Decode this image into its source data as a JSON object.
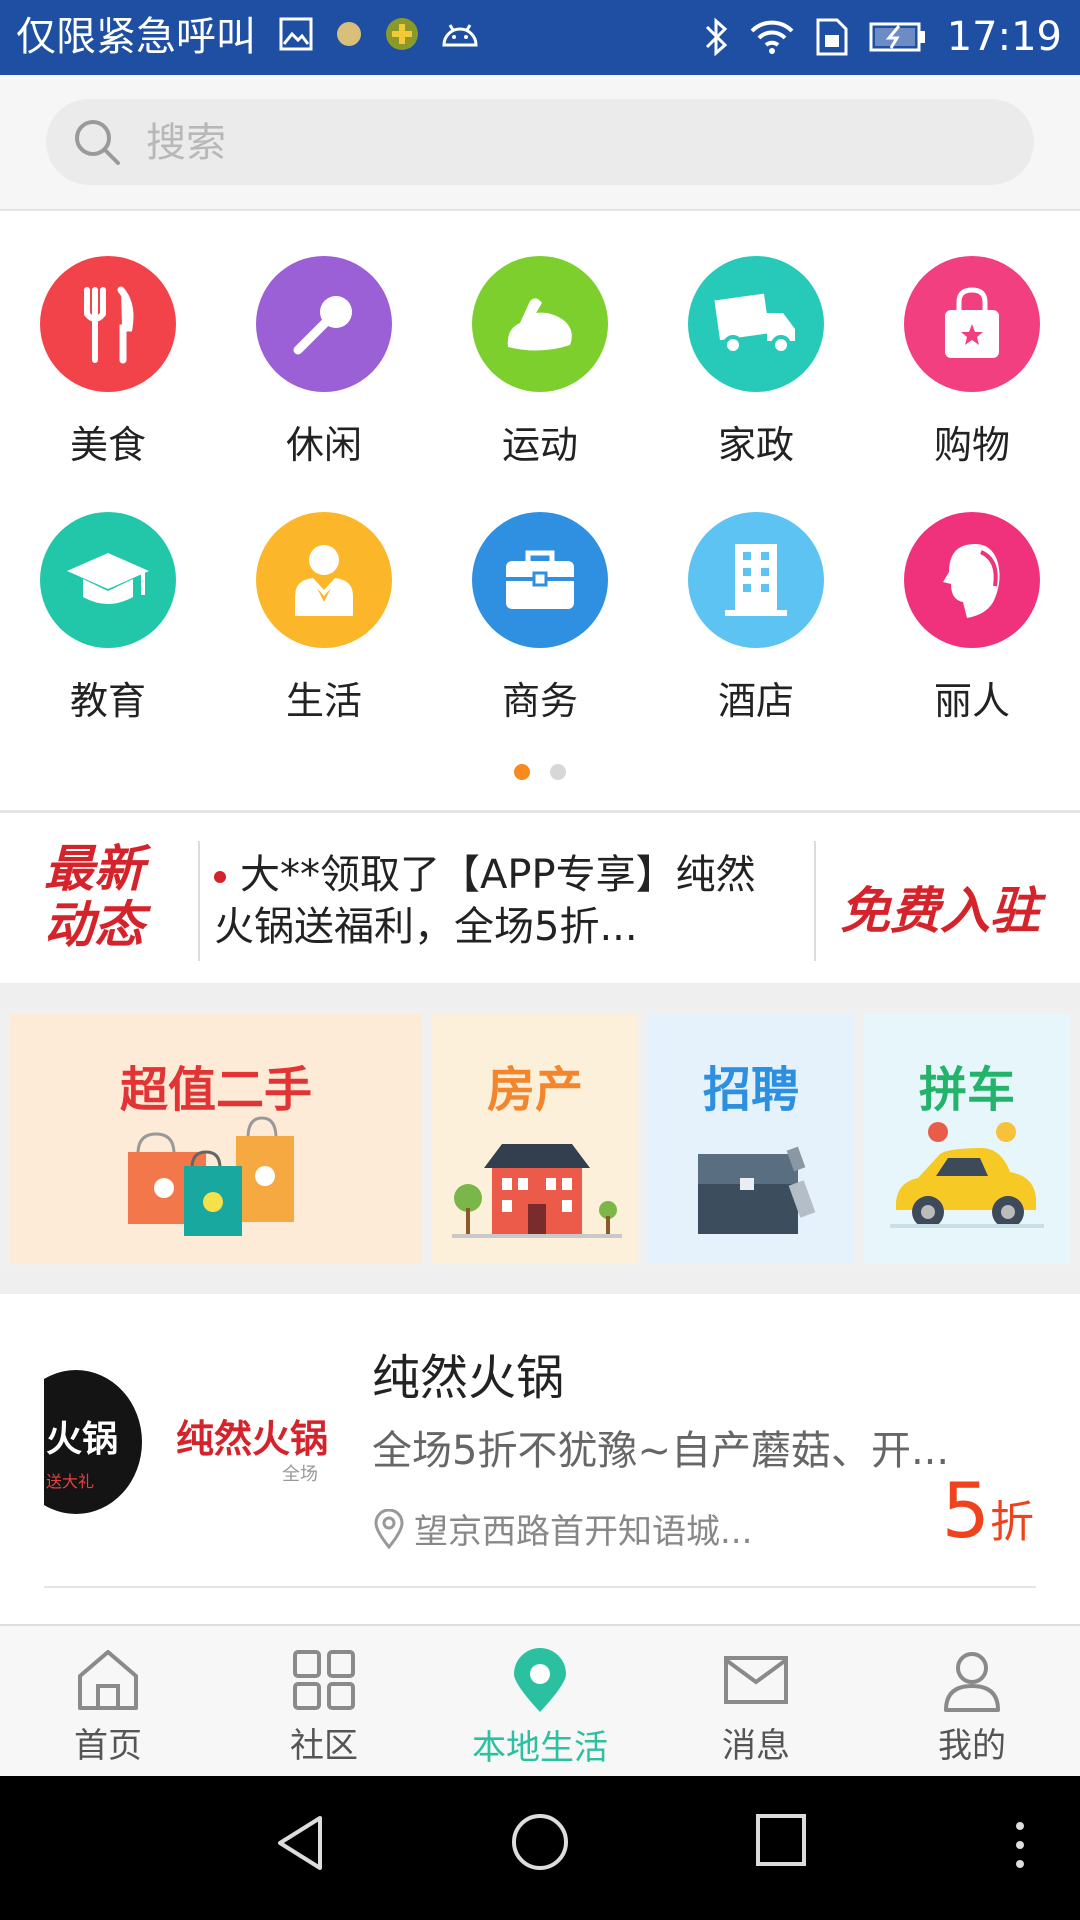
{
  "status_bar": {
    "carrier_text": "仅限紧急呼叫",
    "time": "17:19",
    "icons": [
      "gallery-icon",
      "dot-icon",
      "game-icon",
      "android-icon",
      "bluetooth-icon",
      "wifi-icon",
      "sim-icon",
      "battery-icon"
    ]
  },
  "search": {
    "placeholder": "搜索",
    "value": ""
  },
  "categories": [
    {
      "label": "美食",
      "icon": "fork-knife-icon",
      "color": "#f2434b"
    },
    {
      "label": "休闲",
      "icon": "microphone-icon",
      "color": "#9b5fd6"
    },
    {
      "label": "运动",
      "icon": "bicep-icon",
      "color": "#7dcf2e"
    },
    {
      "label": "家政",
      "icon": "truck-icon",
      "color": "#27c9b8"
    },
    {
      "label": "购物",
      "icon": "shopping-bag-icon",
      "color": "#f23f80"
    },
    {
      "label": "教育",
      "icon": "graduation-cap-icon",
      "color": "#22c6a8"
    },
    {
      "label": "生活",
      "icon": "person-icon",
      "color": "#fbb62a"
    },
    {
      "label": "商务",
      "icon": "briefcase-icon",
      "color": "#2f8fe0"
    },
    {
      "label": "酒店",
      "icon": "building-icon",
      "color": "#5cc3f2"
    },
    {
      "label": "丽人",
      "icon": "woman-profile-icon",
      "color": "#f0327d"
    }
  ],
  "pager": {
    "total": 2,
    "active": 1
  },
  "news": {
    "title_line1": "最新",
    "title_line2": "动态",
    "text": "大**领取了【APP专享】纯然火锅送福利，全场5折...",
    "join_label": "免费入驻"
  },
  "promos": [
    {
      "label": "超值二手",
      "color": "#e23434",
      "bg": "#fdebd8"
    },
    {
      "label": "房产",
      "color": "#f3862c",
      "bg": "#fdf0db"
    },
    {
      "label": "招聘",
      "color": "#2c8fe0",
      "bg": "#e6f2fb"
    },
    {
      "label": "拼车",
      "color": "#23b36b",
      "bg": "#e6f6fb"
    }
  ],
  "listing": {
    "title": "纯然火锅",
    "desc": "全场5折不犹豫~自产蘑菇、开...",
    "address": "望京西路首开知语城...",
    "discount_num": "5",
    "discount_unit": "折",
    "thumb_text_logo": "火锅",
    "thumb_text_sub": "送大礼",
    "thumb_text_name": "纯然火锅",
    "thumb_text_small": "全场"
  },
  "tabs": [
    {
      "label": "首页",
      "icon": "home-icon"
    },
    {
      "label": "社区",
      "icon": "grid-icon"
    },
    {
      "label": "本地生活",
      "icon": "location-pin-icon",
      "active": true
    },
    {
      "label": "消息",
      "icon": "mail-icon"
    },
    {
      "label": "我的",
      "icon": "user-icon"
    }
  ],
  "colors": {
    "accent": "#2bc1a0",
    "status_bar": "#1e4fa3",
    "news_red": "#d5232b",
    "discount": "#f0421c"
  }
}
